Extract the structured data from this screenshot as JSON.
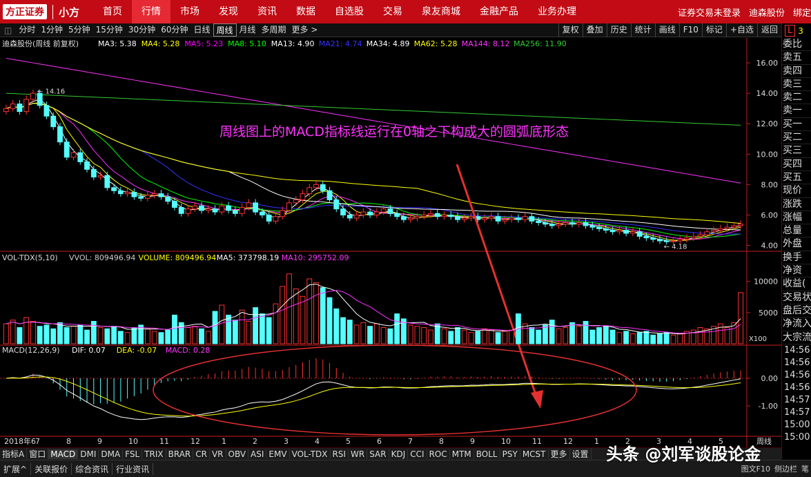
{
  "nav": {
    "logo": "方正证券",
    "logo_sub": "小方",
    "items": [
      "首页",
      "行情",
      "市场",
      "发现",
      "资讯",
      "数据",
      "自选股",
      "交易",
      "泉友商城",
      "金融产品",
      "业务办理"
    ],
    "active": 1,
    "right": [
      "证券交易未登录",
      "迪森股份",
      "绑定"
    ]
  },
  "toolbar": {
    "periods": [
      "分时",
      "1分钟",
      "5分钟",
      "15分钟",
      "30分钟",
      "60分钟",
      "日线",
      "周线",
      "月线",
      "多周期",
      "更多 >"
    ],
    "active": 7,
    "right_buttons": [
      "复权",
      "叠加",
      "历史",
      "统计",
      "画线",
      "F10",
      "标记",
      "+自选",
      "返回"
    ]
  },
  "main_panel": {
    "title": "迪森股份(周线 前复权)",
    "ma_items": [
      {
        "label": "MA3: 5.38",
        "color": "#ffffff"
      },
      {
        "label": "MA4: 5.28",
        "color": "#ffff00"
      },
      {
        "label": "MA5: 5.23",
        "color": "#ff00ff"
      },
      {
        "label": "MA8: 5.10",
        "color": "#00ff00"
      },
      {
        "label": "MA13: 4.90",
        "color": "#ffffff"
      },
      {
        "label": "MA21: 4.74",
        "color": "#3333ff"
      },
      {
        "label": "MA34: 4.89",
        "color": "#ffffff"
      },
      {
        "label": "MA62: 5.28",
        "color": "#ffff00"
      },
      {
        "label": "MA144: 8.12",
        "color": "#ff33ff"
      },
      {
        "label": "MA256: 11.90",
        "color": "#33cc33"
      }
    ],
    "price_axis": [
      "16.00",
      "14.00",
      "12.00",
      "10.00",
      "8.00",
      "6.00",
      "4.00"
    ],
    "high_label": "14.16",
    "low_label": "4.18",
    "annotation": "周线图上的MACD指标线运行在0轴之下构成大的圆弧底形态"
  },
  "vol_panel": {
    "title": "VOL-TDX(5,10)",
    "items": [
      {
        "label": "VVOL: 809496.94",
        "color": "#cccccc"
      },
      {
        "label": "VOLUME: 809496.94",
        "color": "#ffff00"
      },
      {
        "label": "MA5: 373798.19",
        "color": "#ffffff"
      },
      {
        "label": "MA10: 295752.09",
        "color": "#ff33ff"
      }
    ],
    "axis": [
      "10000",
      "5000"
    ],
    "unit": "X100"
  },
  "macd_panel": {
    "title": "MACD(12,26,9)",
    "items": [
      {
        "label": "DIF: 0.07",
        "color": "#ffffff"
      },
      {
        "label": "DEA: -0.07",
        "color": "#ffff00"
      },
      {
        "label": "MACD: 0.28",
        "color": "#ff33ff"
      }
    ],
    "axis": [
      "0.00",
      "-1.00"
    ]
  },
  "date_axis": [
    "2018年6",
    "7",
    "8",
    "9",
    "10",
    "11",
    "12",
    "1",
    "2",
    "3",
    "4",
    "5",
    "6",
    "7",
    "8",
    "9",
    "10",
    "11",
    "12",
    "1",
    "2",
    "3",
    "4",
    "5"
  ],
  "right_panel": {
    "L": "L",
    "num": "3",
    "labels": [
      "委比",
      "卖五",
      "卖四",
      "卖三",
      "卖二",
      "卖一",
      "买一",
      "买二",
      "买三",
      "买四",
      "买五",
      "现价",
      "涨跌",
      "涨幅",
      "总量",
      "外盘",
      "换手",
      "净资",
      "收益(",
      "交易状",
      "盘后交",
      "净流入",
      "大宗流"
    ],
    "times": [
      "14:56",
      "14:56",
      "14:56",
      "14:56",
      "14:57",
      "14:57",
      "15:00",
      "15:00"
    ]
  },
  "indicators": [
    "指标A",
    "窗口",
    "MACD",
    "DMI",
    "DMA",
    "FSL",
    "TRIX",
    "BRAR",
    "CR",
    "VR",
    "OBV",
    "ASI",
    "EMV",
    "VOL-TDX",
    "RSI",
    "WR",
    "SAR",
    "KDJ",
    "CCI",
    "ROC",
    "MTM",
    "BOLL",
    "PSY",
    "MCST",
    "更多",
    "设置"
  ],
  "bottom_tabs": [
    "扩展^",
    "关联报价",
    "综合资讯",
    "行业资讯"
  ],
  "bottom_right": [
    "图文F10",
    "侧边栏",
    "笔"
  ],
  "weekly_label": "周线",
  "watermark": "头条 @刘军谈股论金",
  "colors": {
    "up": "#ff3232",
    "down": "#54ffff",
    "bg": "#000000",
    "nav": "#c20b14"
  },
  "chart_data": {
    "type": "candlestick",
    "close": [
      13.0,
      13.3,
      12.8,
      13.6,
      14.0,
      13.2,
      12.5,
      11.8,
      10.8,
      9.8,
      10.1,
      9.5,
      9.0,
      8.5,
      8.6,
      7.8,
      7.6,
      7.4,
      7.5,
      7.2,
      7.1,
      7.3,
      7.4,
      7.2,
      6.9,
      6.5,
      6.1,
      6.4,
      6.6,
      6.3,
      6.4,
      6.2,
      6.6,
      6.3,
      6.1,
      6.5,
      6.8,
      6.2,
      6.0,
      5.6,
      5.9,
      6.3,
      6.8,
      7.0,
      7.4,
      7.8,
      8.0,
      7.6,
      7.0,
      6.4,
      6.0,
      5.8,
      6.0,
      6.2,
      6.0,
      6.2,
      6.4,
      6.1,
      5.9,
      5.7,
      5.8,
      5.9,
      6.0,
      6.1,
      5.9,
      6.0,
      5.9,
      5.7,
      5.8,
      5.9,
      5.7,
      5.8,
      5.9,
      5.6,
      5.7,
      5.8,
      5.7,
      5.9,
      5.6,
      5.5,
      5.4,
      5.3,
      5.4,
      5.5,
      5.4,
      5.5,
      5.3,
      5.2,
      5.1,
      5.0,
      4.9,
      5.0,
      4.8,
      4.9,
      4.6,
      4.5,
      4.4,
      4.3,
      4.25,
      4.3,
      4.4,
      4.5,
      4.6,
      4.7,
      4.9,
      5.0,
      5.1,
      5.2,
      5.3,
      5.4
    ],
    "volume": [
      3200,
      3800,
      2600,
      4200,
      3600,
      2800,
      3000,
      2400,
      3400,
      2600,
      2800,
      3000,
      2200,
      3600,
      2600,
      2400,
      2800,
      2000,
      1800,
      2600,
      3000,
      2400,
      2000,
      1800,
      2200,
      4600,
      3400,
      2600,
      2800,
      2400,
      2000,
      5200,
      6200,
      4600,
      3800,
      5400,
      3600,
      5800,
      4800,
      4200,
      6400,
      9200,
      11200,
      8800,
      7600,
      10400,
      9800,
      9000,
      7400,
      5600,
      4200,
      3800,
      3000,
      3400,
      2800,
      3200,
      2600,
      2400,
      4800,
      4000,
      3000,
      2800,
      2600,
      2200,
      3200,
      2400,
      2000,
      2600,
      2200,
      1800,
      2000,
      2400,
      2200,
      1800,
      2000,
      2200,
      4800,
      3200,
      2600,
      2200,
      3000,
      3800,
      2400,
      2600,
      3400,
      2800,
      3600,
      2200,
      2600,
      2800,
      2200,
      1800,
      2000,
      1600,
      1800,
      2000,
      1400,
      1600,
      1800,
      1400,
      1600,
      2000,
      2200,
      2600,
      2400,
      2800,
      3200,
      2600,
      3400,
      8200
    ],
    "annotation_text": "周线图上的MACD指标线运行在0轴之下构成大的圆弧底形态"
  }
}
